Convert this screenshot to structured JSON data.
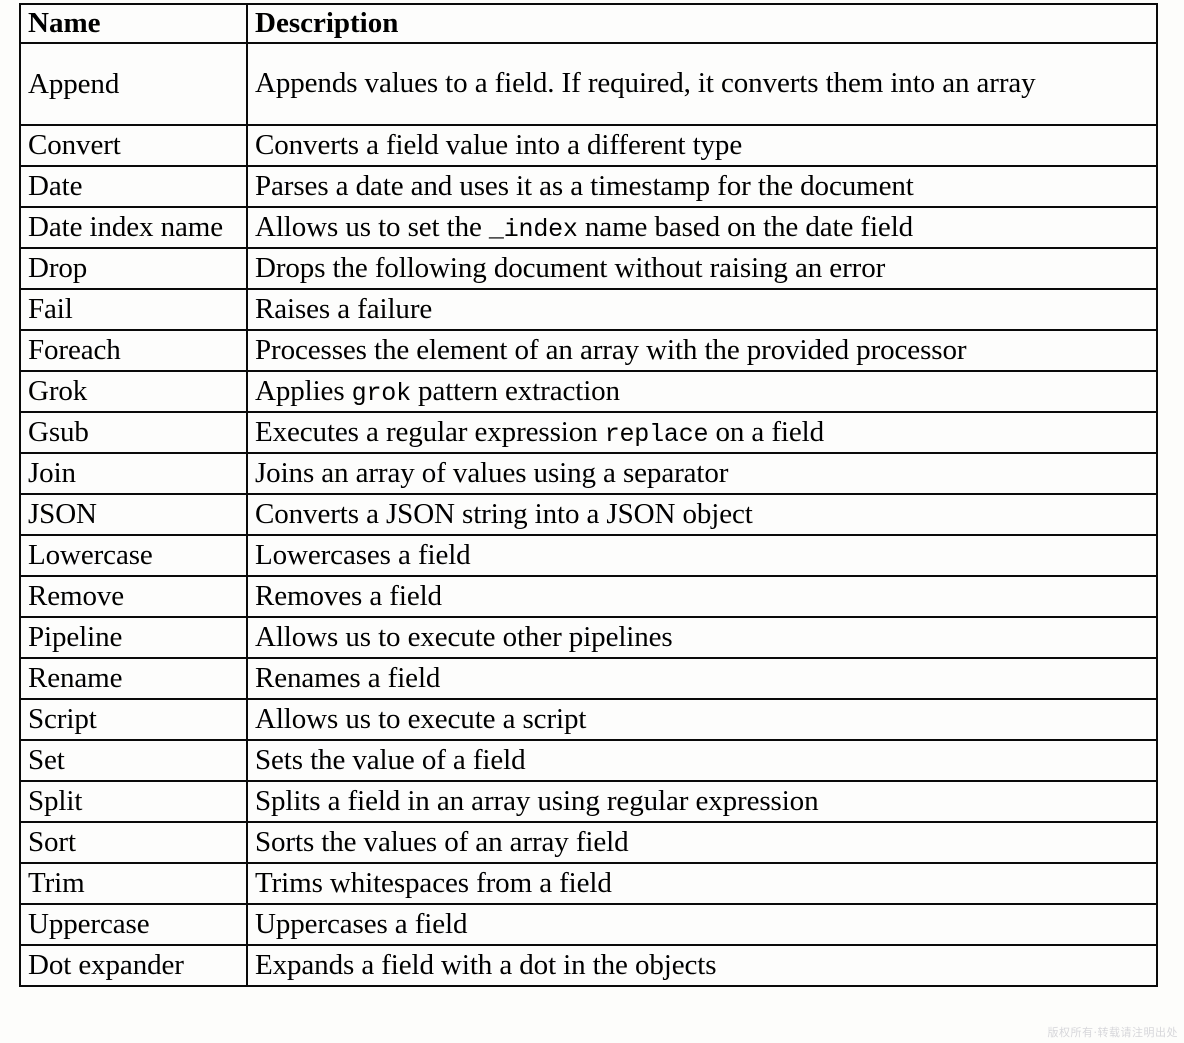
{
  "document": {
    "kind": "reference-table",
    "background_color": "#fdfdfb",
    "border_color": "#0a0a0a"
  },
  "table": {
    "headers": {
      "name": "Name",
      "description": "Description"
    },
    "rows": [
      {
        "name": "Append",
        "description_pre": "Appends values to a field. If required, it converts them into an array",
        "mono": "",
        "description_post": "",
        "tall": true
      },
      {
        "name": "Convert",
        "description_pre": "Converts a field value into a different type",
        "mono": "",
        "description_post": "",
        "tall": false
      },
      {
        "name": "Date",
        "description_pre": "Parses a date and uses it as a timestamp for the document",
        "mono": "",
        "description_post": "",
        "tall": false
      },
      {
        "name": "Date index name",
        "description_pre": "Allows us to set the ",
        "mono": "_index",
        "description_post": " name based on the date field",
        "tall": false
      },
      {
        "name": "Drop",
        "description_pre": "Drops the following document without raising an error",
        "mono": "",
        "description_post": "",
        "tall": false
      },
      {
        "name": "Fail",
        "description_pre": "Raises a failure",
        "mono": "",
        "description_post": "",
        "tall": false
      },
      {
        "name": "Foreach",
        "description_pre": "Processes the element of an array with the provided processor",
        "mono": "",
        "description_post": "",
        "tall": false
      },
      {
        "name": "Grok",
        "description_pre": "Applies ",
        "mono": "grok",
        "description_post": " pattern extraction",
        "tall": false
      },
      {
        "name": "Gsub",
        "description_pre": "Executes a regular expression ",
        "mono": "replace",
        "description_post": " on a field",
        "tall": false
      },
      {
        "name": "Join",
        "description_pre": "Joins an array of values using a separator",
        "mono": "",
        "description_post": "",
        "tall": false
      },
      {
        "name": "JSON",
        "description_pre": "Converts a JSON string into a JSON object",
        "mono": "",
        "description_post": "",
        "tall": false
      },
      {
        "name": "Lowercase",
        "description_pre": "Lowercases a field",
        "mono": "",
        "description_post": "",
        "tall": false
      },
      {
        "name": "Remove",
        "description_pre": "Removes a field",
        "mono": "",
        "description_post": "",
        "tall": false
      },
      {
        "name": "Pipeline",
        "description_pre": "Allows us to execute other pipelines",
        "mono": "",
        "description_post": "",
        "tall": false
      },
      {
        "name": "Rename",
        "description_pre": "Renames a field",
        "mono": "",
        "description_post": "",
        "tall": false
      },
      {
        "name": "Script",
        "description_pre": "Allows us to execute a script",
        "mono": "",
        "description_post": "",
        "tall": false
      },
      {
        "name": "Set",
        "description_pre": "Sets the value of a field",
        "mono": "",
        "description_post": "",
        "tall": false
      },
      {
        "name": "Split",
        "description_pre": "Splits a field in an array using regular expression",
        "mono": "",
        "description_post": "",
        "tall": false
      },
      {
        "name": "Sort",
        "description_pre": "Sorts the values of an array field",
        "mono": "",
        "description_post": "",
        "tall": false
      },
      {
        "name": "Trim",
        "description_pre": "Trims whitespaces from a field",
        "mono": "",
        "description_post": "",
        "tall": false
      },
      {
        "name": "Uppercase",
        "description_pre": "Uppercases a field",
        "mono": "",
        "description_post": "",
        "tall": false
      },
      {
        "name": "Dot expander",
        "description_pre": "Expands a field with a dot in the objects",
        "mono": "",
        "description_post": "",
        "tall": false
      }
    ]
  },
  "watermark": {
    "text": "版权所有·转载请注明出处"
  }
}
